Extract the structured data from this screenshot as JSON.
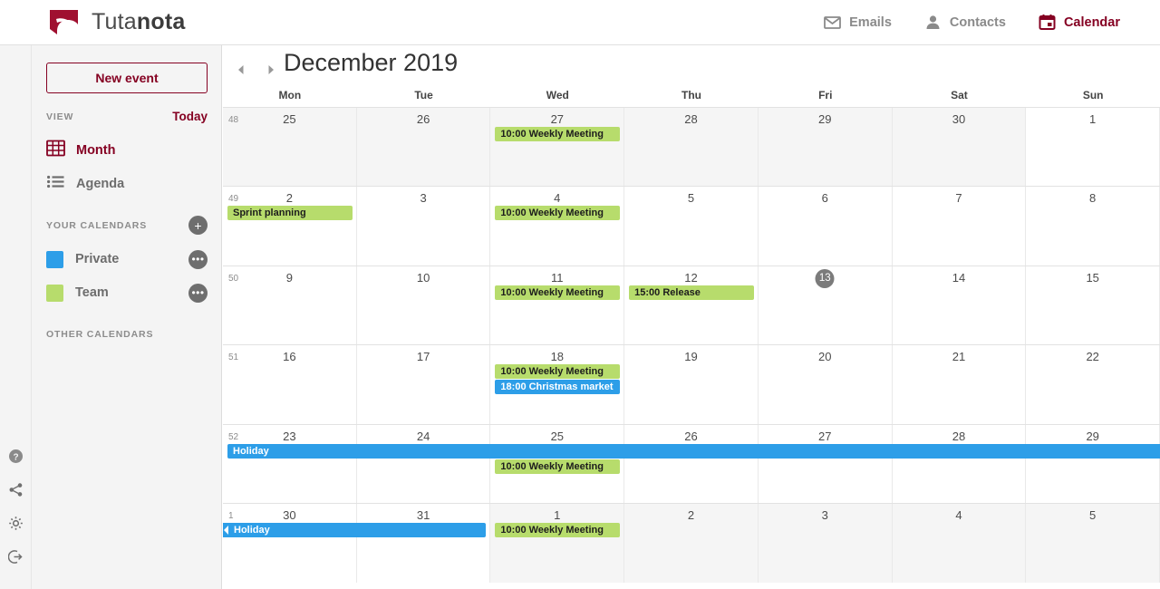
{
  "header": {
    "brand_prefix": "Tuta",
    "brand_suffix": "nota",
    "nav": [
      {
        "label": "Emails",
        "icon": "mail-icon",
        "active": false
      },
      {
        "label": "Contacts",
        "icon": "person-icon",
        "active": false
      },
      {
        "label": "Calendar",
        "icon": "calendar-icon",
        "active": true
      }
    ]
  },
  "sidebar": {
    "new_event_label": "New event",
    "view_section_label": "VIEW",
    "today_label": "Today",
    "views": [
      {
        "label": "Month",
        "icon": "grid-icon",
        "active": true
      },
      {
        "label": "Agenda",
        "icon": "list-icon",
        "active": false
      }
    ],
    "your_calendars_label": "YOUR CALENDARS",
    "add_calendar_label": "+",
    "calendar_options_label": "•••",
    "calendars": [
      {
        "name": "Private",
        "color": "#2d9ee8"
      },
      {
        "name": "Team",
        "color": "#b7dc6c"
      }
    ],
    "other_calendars_label": "OTHER CALENDARS",
    "rail_icons": [
      {
        "name": "help-icon"
      },
      {
        "name": "share-icon"
      },
      {
        "name": "settings-icon"
      },
      {
        "name": "logout-icon"
      }
    ]
  },
  "calendar": {
    "title": "December 2019",
    "prev_label": "◄",
    "next_label": "►",
    "weekdays": [
      "Mon",
      "Tue",
      "Wed",
      "Thu",
      "Fri",
      "Sat",
      "Sun"
    ],
    "today_day": "13",
    "accent_red": "#850122",
    "event_green": "#b7dc6c",
    "event_blue": "#2d9ee8",
    "weeks": [
      {
        "week_number": "48",
        "days": [
          {
            "num": "25",
            "other": true
          },
          {
            "num": "26",
            "other": true
          },
          {
            "num": "27",
            "other": true
          },
          {
            "num": "28",
            "other": true
          },
          {
            "num": "29",
            "other": true
          },
          {
            "num": "30",
            "other": true
          },
          {
            "num": "1",
            "other": false
          }
        ],
        "events": [
          {
            "title": "10:00 Weekly Meeting",
            "color": "green",
            "start": 2,
            "span": 1,
            "row": 0
          }
        ]
      },
      {
        "week_number": "49",
        "days": [
          {
            "num": "2",
            "other": false
          },
          {
            "num": "3",
            "other": false
          },
          {
            "num": "4",
            "other": false
          },
          {
            "num": "5",
            "other": false
          },
          {
            "num": "6",
            "other": false
          },
          {
            "num": "7",
            "other": false
          },
          {
            "num": "8",
            "other": false
          }
        ],
        "events": [
          {
            "title": "Sprint planning",
            "color": "green",
            "start": 0,
            "span": 1,
            "row": 0
          },
          {
            "title": "10:00 Weekly Meeting",
            "color": "green",
            "start": 2,
            "span": 1,
            "row": 0
          }
        ]
      },
      {
        "week_number": "50",
        "days": [
          {
            "num": "9",
            "other": false
          },
          {
            "num": "10",
            "other": false
          },
          {
            "num": "11",
            "other": false
          },
          {
            "num": "12",
            "other": false
          },
          {
            "num": "13",
            "other": false,
            "today": true
          },
          {
            "num": "14",
            "other": false
          },
          {
            "num": "15",
            "other": false
          }
        ],
        "events": [
          {
            "title": "10:00 Weekly Meeting",
            "color": "green",
            "start": 2,
            "span": 1,
            "row": 0
          },
          {
            "title": "15:00 Release",
            "color": "green",
            "start": 3,
            "span": 1,
            "row": 0
          }
        ]
      },
      {
        "week_number": "51",
        "days": [
          {
            "num": "16",
            "other": false
          },
          {
            "num": "17",
            "other": false
          },
          {
            "num": "18",
            "other": false
          },
          {
            "num": "19",
            "other": false
          },
          {
            "num": "20",
            "other": false
          },
          {
            "num": "21",
            "other": false
          },
          {
            "num": "22",
            "other": false
          }
        ],
        "events": [
          {
            "title": "10:00 Weekly Meeting",
            "color": "green",
            "start": 2,
            "span": 1,
            "row": 0
          },
          {
            "title": "18:00 Christmas market",
            "color": "blue",
            "start": 2,
            "span": 1,
            "row": 1
          }
        ]
      },
      {
        "week_number": "52",
        "days": [
          {
            "num": "23",
            "other": false
          },
          {
            "num": "24",
            "other": false
          },
          {
            "num": "25",
            "other": false
          },
          {
            "num": "26",
            "other": false
          },
          {
            "num": "27",
            "other": false
          },
          {
            "num": "28",
            "other": false
          },
          {
            "num": "29",
            "other": false
          }
        ],
        "events": [
          {
            "title": "Holiday",
            "color": "blue",
            "start": 0,
            "span": 7,
            "row": 0,
            "continues_right": true
          },
          {
            "title": "10:00 Weekly Meeting",
            "color": "green",
            "start": 2,
            "span": 1,
            "row": 1
          }
        ]
      },
      {
        "week_number": "1",
        "days": [
          {
            "num": "30",
            "other": false
          },
          {
            "num": "31",
            "other": false
          },
          {
            "num": "1",
            "other": true
          },
          {
            "num": "2",
            "other": true
          },
          {
            "num": "3",
            "other": true
          },
          {
            "num": "4",
            "other": true
          },
          {
            "num": "5",
            "other": true
          }
        ],
        "events": [
          {
            "title": "Holiday",
            "color": "blue",
            "start": 0,
            "span": 2,
            "row": 0,
            "continues_left": true
          },
          {
            "title": "10:00 Weekly Meeting",
            "color": "green",
            "start": 2,
            "span": 1,
            "row": 0
          }
        ]
      }
    ]
  }
}
